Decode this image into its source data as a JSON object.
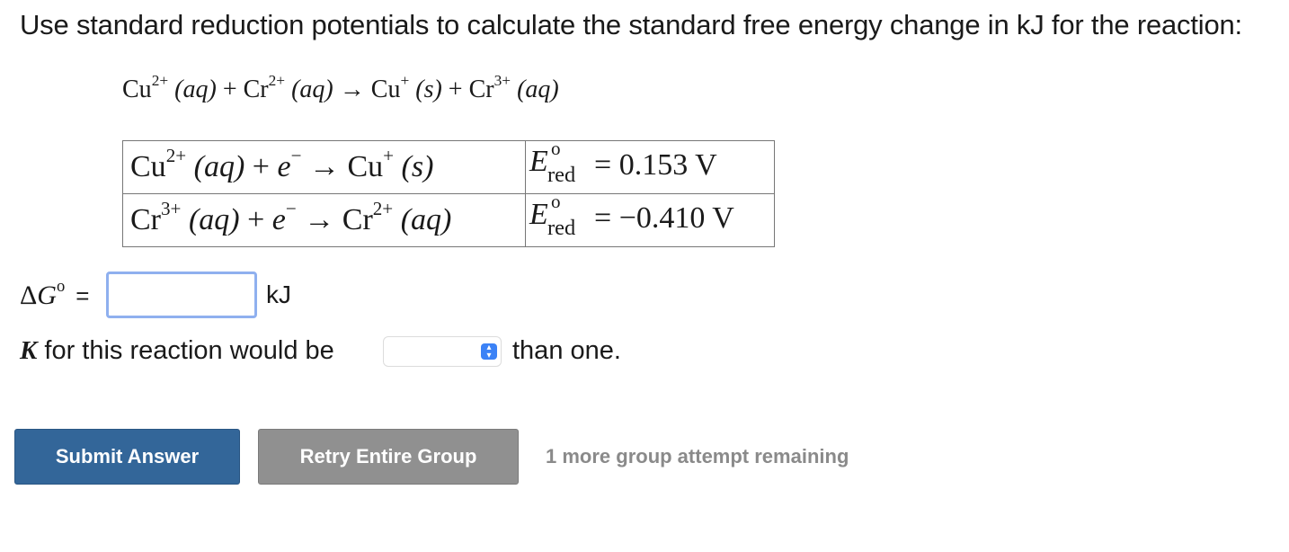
{
  "question": {
    "text": "Use standard reduction potentials to calculate the standard free energy change in kJ for the reaction:"
  },
  "overall_reaction": {
    "reactant1": "Cu",
    "reactant1_charge": "2+",
    "reactant1_state": "(aq)",
    "plus1": "+",
    "reactant2": "Cr",
    "reactant2_charge": "2+",
    "reactant2_state": "(aq)",
    "arrow": "→",
    "product1": "Cu",
    "product1_charge": "+",
    "product1_state": "(s)",
    "plus2": "+",
    "product2": "Cr",
    "product2_charge": "3+",
    "product2_state": "(aq)"
  },
  "half_reactions": [
    {
      "species": "Cu",
      "charge": "2+",
      "state": "(aq)",
      "plus": "+",
      "electron": "e",
      "electron_charge": "−",
      "arrow": "→",
      "product": "Cu",
      "product_charge": "+",
      "product_state": "(s)",
      "E_symbol": "E",
      "E_super": "o",
      "E_sub": "red",
      "equals": "=",
      "value": "0.153 V"
    },
    {
      "species": "Cr",
      "charge": "3+",
      "state": "(aq)",
      "plus": "+",
      "electron": "e",
      "electron_charge": "−",
      "arrow": "→",
      "product": "Cr",
      "product_charge": "2+",
      "product_state": "(aq)",
      "E_symbol": "E",
      "E_super": "o",
      "E_sub": "red",
      "equals": "=",
      "value": "−0.410 V"
    }
  ],
  "delta_g": {
    "label_delta": "Δ",
    "label_g": "G",
    "label_o": "o",
    "equals": "=",
    "value": "",
    "unit": "kJ"
  },
  "k_question": {
    "k_symbol": "K",
    "text_before": "for this reaction would be",
    "selected": "",
    "text_after": "than one."
  },
  "buttons": {
    "submit": "Submit Answer",
    "retry": "Retry Entire Group"
  },
  "attempts_text": "1 more group attempt remaining",
  "colors": {
    "submit_bg": "#336699",
    "retry_bg": "#909090",
    "input_border": "#8fb0ef",
    "select_arrow": "#3b82f6"
  }
}
